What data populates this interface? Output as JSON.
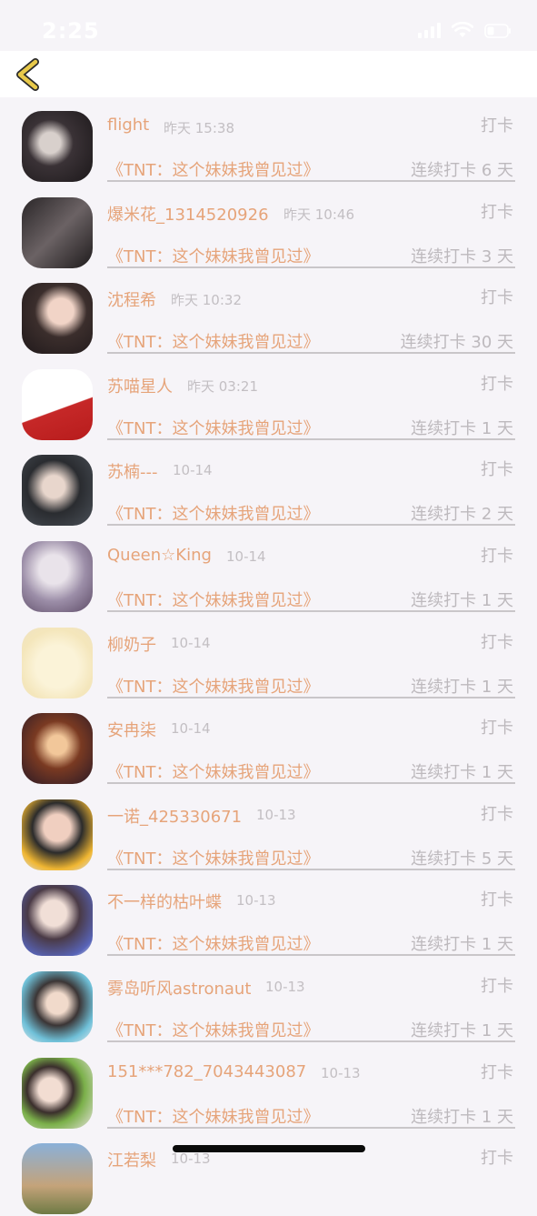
{
  "status_bar": {
    "time": "2:25"
  },
  "nav": {
    "back_icon": "chevron-left-icon"
  },
  "colors": {
    "accent": "#e6a47a",
    "muted": "#bdb9bd",
    "background": "#f6f4f8"
  },
  "items": [
    {
      "name": "flight",
      "time": "昨天 15:38",
      "action": "打卡",
      "topic": "《TNT：这个妹妹我曾见过》",
      "streak": "连续打卡 6 天"
    },
    {
      "name": "爆米花_1314520926",
      "time": "昨天 10:46",
      "action": "打卡",
      "topic": "《TNT：这个妹妹我曾见过》",
      "streak": "连续打卡 3 天"
    },
    {
      "name": "沈程希",
      "time": "昨天 10:32",
      "action": "打卡",
      "topic": "《TNT：这个妹妹我曾见过》",
      "streak": "连续打卡 30 天"
    },
    {
      "name": "苏喵星人",
      "time": "昨天 03:21",
      "action": "打卡",
      "topic": "《TNT：这个妹妹我曾见过》",
      "streak": "连续打卡 1 天"
    },
    {
      "name": "苏楠---",
      "time": "10-14",
      "action": "打卡",
      "topic": "《TNT：这个妹妹我曾见过》",
      "streak": "连续打卡 2 天"
    },
    {
      "name": "Queen☆King",
      "time": "10-14",
      "action": "打卡",
      "topic": "《TNT：这个妹妹我曾见过》",
      "streak": "连续打卡 1 天"
    },
    {
      "name": "柳奶子",
      "time": "10-14",
      "action": "打卡",
      "topic": "《TNT：这个妹妹我曾见过》",
      "streak": "连续打卡 1 天"
    },
    {
      "name": "安冉柒",
      "time": "10-14",
      "action": "打卡",
      "topic": "《TNT：这个妹妹我曾见过》",
      "streak": "连续打卡 1 天"
    },
    {
      "name": "一诺_425330671",
      "time": "10-13",
      "action": "打卡",
      "topic": "《TNT：这个妹妹我曾见过》",
      "streak": "连续打卡 5 天"
    },
    {
      "name": "不一样的枯叶蝶",
      "time": "10-13",
      "action": "打卡",
      "topic": "《TNT：这个妹妹我曾见过》",
      "streak": "连续打卡 1 天"
    },
    {
      "name": "雾岛听风astronaut",
      "time": "10-13",
      "action": "打卡",
      "topic": "《TNT：这个妹妹我曾见过》",
      "streak": "连续打卡 1 天"
    },
    {
      "name": "151***782_7043443087",
      "time": "10-13",
      "action": "打卡",
      "topic": "《TNT：这个妹妹我曾见过》",
      "streak": "连续打卡 1 天"
    },
    {
      "name": "江若梨",
      "time": "10-13",
      "action": "打卡",
      "topic": "",
      "streak": ""
    }
  ]
}
